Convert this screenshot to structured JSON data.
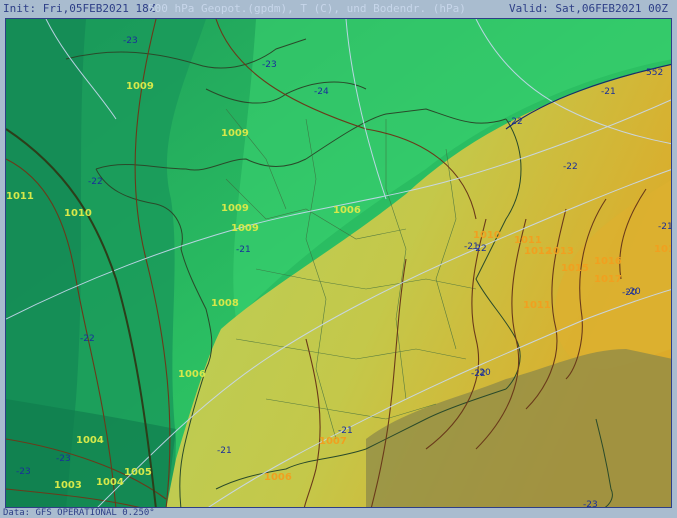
{
  "header": {
    "init": "Init: Fri,05FEB2021 18Z",
    "title": "500 hPa Geopot.(gpdm), T (C), und Bodendr. (hPa)",
    "valid": "Valid: Sat,06FEB2021 00Z"
  },
  "footer": {
    "text": "Data: GFS OPERATIONAL 0.250°"
  },
  "map": {
    "geopot_label": "552",
    "pressure_labels": [
      "1009",
      "1009",
      "1009",
      "1009",
      "1011",
      "1010",
      "1008",
      "1006",
      "1006",
      "1004",
      "1005",
      "1004",
      "1003",
      "1007",
      "1006",
      "1010",
      "1011",
      "1012",
      "1013",
      "1015",
      "1016",
      "1017",
      "1017",
      "1011"
    ],
    "temperature_labels": [
      "-23",
      "-23",
      "-24",
      "-22",
      "-21",
      "-22",
      "-22",
      "-21",
      "-21",
      "-21",
      "-22",
      "-22",
      "-23",
      "-21",
      "-23",
      "-21",
      "-20",
      "-23",
      "-22",
      "-20",
      "-20"
    ],
    "colors": {
      "green_dark": "#128a55",
      "green": "#25b860",
      "green_light": "#3ed470",
      "yellow_green": "#b4cf5a",
      "yellow": "#cdbd3e",
      "gold": "#d9aa2a",
      "land_outline": "#3a5a3a",
      "isobar": "#6a3a1a",
      "isotherm": "#c8d8f0"
    }
  }
}
